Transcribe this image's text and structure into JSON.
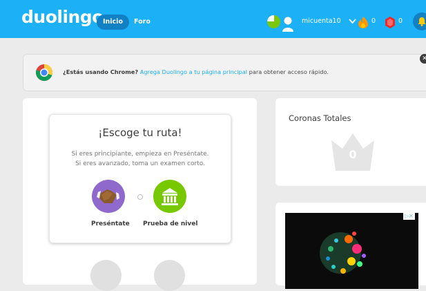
{
  "header": {
    "logo": "duolingo",
    "nav": [
      {
        "label": "Inicio",
        "active": true
      },
      {
        "label": "Foro",
        "active": false
      }
    ],
    "username": "micuenta10",
    "streak_count": "0",
    "gems_count": "0"
  },
  "banner": {
    "bold_text": "¿Estás usando Chrome?",
    "link_text": "Agrega Duolingo a tu página principal",
    "rest_text": "para obtener acceso rápido."
  },
  "route": {
    "title": "¡Escoge tu ruta!",
    "desc_line1": "Si eres principiante, empieza en Preséntate.",
    "desc_line2": "Si eres avanzado, toma un examen corto.",
    "option_left": "Preséntate",
    "option_right": "Prueba de nivel"
  },
  "crowns": {
    "title": "Coronas Totales",
    "count": "0"
  },
  "colors": {
    "brand": "#1cb0f6",
    "green": "#78c800",
    "purple": "#9069cd",
    "streak": "#ff9600",
    "gem": "#ea2b2b"
  }
}
